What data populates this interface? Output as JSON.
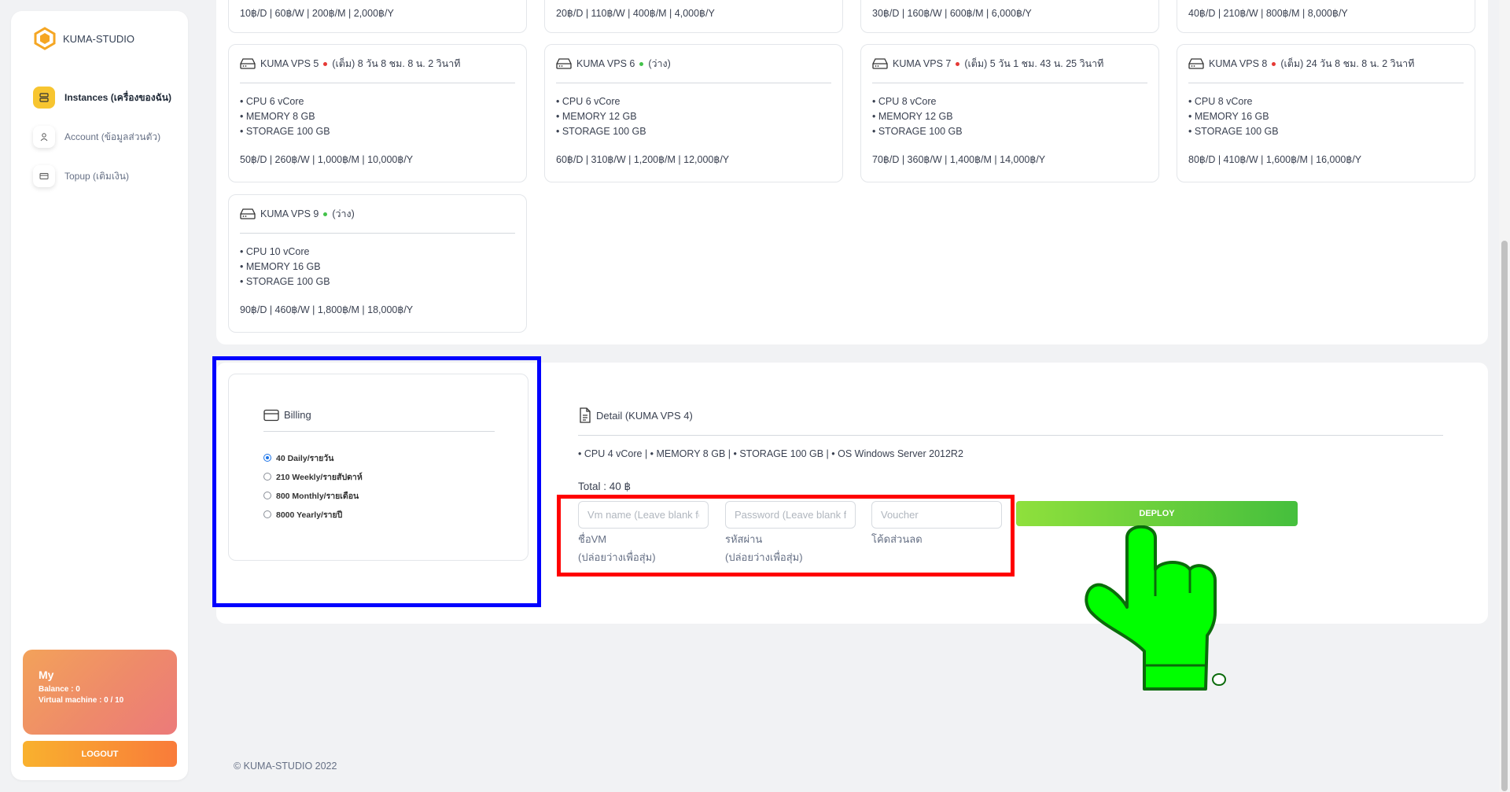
{
  "sidebar": {
    "brand": "KUMA-STUDIO",
    "items": [
      {
        "label": "Instances (เครื่องของฉัน)",
        "icon": "server-icon",
        "active": true
      },
      {
        "label": "Account (ข้อมูลส่วนตัว)",
        "icon": "user-icon",
        "active": false
      },
      {
        "label": "Topup (เติมเงิน)",
        "icon": "card-icon",
        "active": false
      }
    ],
    "user": {
      "name": "My",
      "balance": "Balance : 0",
      "vms": "Virtual machine : 0 / 10"
    },
    "logout": "LOGOUT"
  },
  "partial_prices": [
    "10฿/D | 60฿/W | 200฿/M | 2,000฿/Y",
    "20฿/D | 110฿/W | 400฿/M | 4,000฿/Y",
    "30฿/D | 160฿/W | 600฿/M | 6,000฿/Y",
    "40฿/D | 210฿/W | 800฿/M | 8,000฿/Y"
  ],
  "vps": [
    {
      "name": "KUMA VPS 5",
      "status": "(เต็ม) 8 วัน 8 ชม. 8 น. 2 วินาที",
      "dot": "red",
      "cpu": "• CPU 6 vCore",
      "mem": "• MEMORY 8 GB",
      "storage": "• STORAGE 100 GB",
      "price": "50฿/D | 260฿/W | 1,000฿/M | 10,000฿/Y"
    },
    {
      "name": "KUMA VPS 6",
      "status": "(ว่าง)",
      "dot": "green",
      "cpu": "• CPU 6 vCore",
      "mem": "• MEMORY 12 GB",
      "storage": "• STORAGE 100 GB",
      "price": "60฿/D | 310฿/W | 1,200฿/M | 12,000฿/Y"
    },
    {
      "name": "KUMA VPS 7",
      "status": "(เต็ม) 5 วัน 1 ชม. 43 น. 25 วินาที",
      "dot": "red",
      "cpu": "• CPU 8 vCore",
      "mem": "• MEMORY 12 GB",
      "storage": "• STORAGE 100 GB",
      "price": "70฿/D | 360฿/W | 1,400฿/M | 14,000฿/Y"
    },
    {
      "name": "KUMA VPS 8",
      "status": "(เต็ม) 24 วัน 8 ชม. 8 น. 2 วินาที",
      "dot": "red",
      "cpu": "• CPU 8 vCore",
      "mem": "• MEMORY 16 GB",
      "storage": "• STORAGE 100 GB",
      "price": "80฿/D | 410฿/W | 1,600฿/M | 16,000฿/Y"
    },
    {
      "name": "KUMA VPS 9",
      "status": "(ว่าง)",
      "dot": "green",
      "cpu": "• CPU 10 vCore",
      "mem": "• MEMORY 16 GB",
      "storage": "• STORAGE 100 GB",
      "price": "90฿/D | 460฿/W | 1,800฿/M | 18,000฿/Y"
    }
  ],
  "billing": {
    "title": "Billing",
    "options": [
      "40 Daily/รายวัน",
      "210 Weekly/รายสัปดาห์",
      "800 Monthly/รายเดือน",
      "8000 Yearly/รายปี"
    ],
    "selected": 0
  },
  "detail": {
    "title": "Detail (KUMA VPS 4)",
    "specs": "• CPU 4 vCore | • MEMORY 8 GB | • STORAGE 100 GB | • OS Windows Server 2012R2",
    "total": "Total : 40 ฿"
  },
  "form": {
    "vm_placeholder": "Vm name (Leave blank for random)",
    "vm_help_1": "ชื่อVM",
    "vm_help_2": "(ปล่อยว่างเพื่อสุ่ม)",
    "pw_placeholder": "Password (Leave blank for random)",
    "pw_help_1": "รหัสผ่าน",
    "pw_help_2": "(ปล่อยว่างเพื่อสุ่ม)",
    "voucher_placeholder": "Voucher",
    "voucher_help": "โค้ดส่วนลด",
    "deploy": "DEPLOY"
  },
  "footer": "© KUMA-STUDIO 2022",
  "colors": {
    "accent": "#f7c530",
    "deploy": "#45bf3d",
    "highlight_blue": "#0000ff",
    "highlight_red": "#ff0000",
    "pointer": "#00ff00"
  }
}
